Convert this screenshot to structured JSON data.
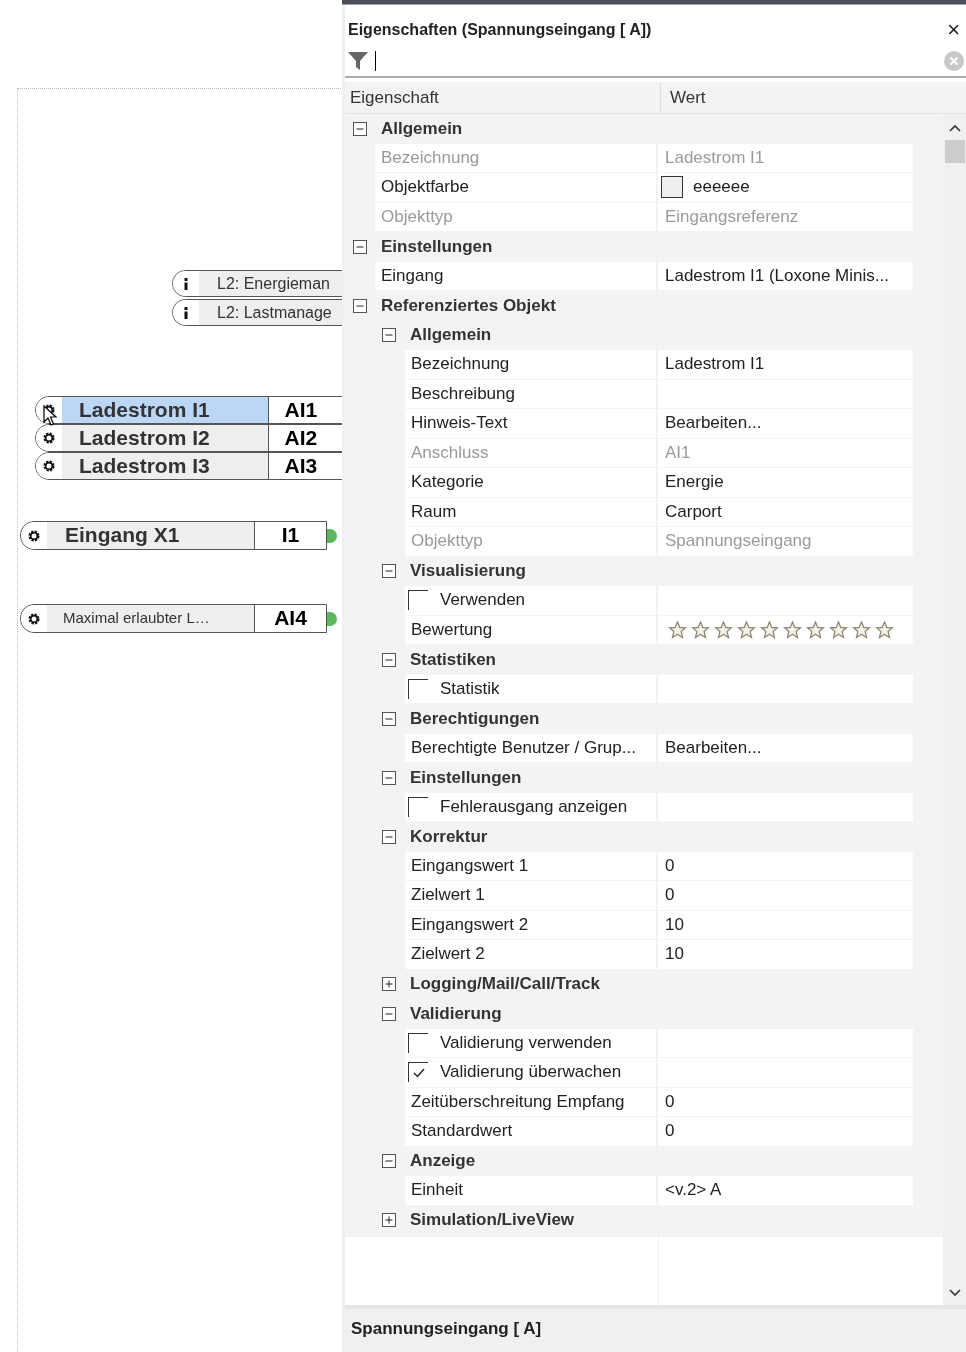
{
  "canvas": {
    "blocks": [
      {
        "kind": "info",
        "label": "L2: Energieman"
      },
      {
        "kind": "info",
        "label": "L2: Lastmanage"
      },
      {
        "kind": "group",
        "rows": [
          {
            "label": "Ladestrom I1",
            "port": "AI1",
            "selected": true
          },
          {
            "label": "Ladestrom I2",
            "port": "AI2",
            "selected": false
          },
          {
            "label": "Ladestrom I3",
            "port": "AI3",
            "selected": false
          }
        ]
      },
      {
        "kind": "input",
        "label": "Eingang X1",
        "port": "I1",
        "connected": true,
        "small": false
      },
      {
        "kind": "input",
        "label": "Maximal  erlaubter L…",
        "port": "AI4",
        "connected": true,
        "small": true
      }
    ]
  },
  "panel": {
    "title": "Eigenschaften (Spannungseingang [ A])",
    "close": "×",
    "columns": [
      "Eigenschaft",
      "Wert"
    ],
    "properties": [
      {
        "kind": "category",
        "label": "Allgemein",
        "expanded": true,
        "children": [
          {
            "kind": "text",
            "name": "Bezeichnung",
            "value": "Ladestrom I1",
            "disabled": true
          },
          {
            "kind": "color",
            "name": "Objektfarbe",
            "value": "eeeeee",
            "color": "#eeeeee"
          },
          {
            "kind": "text",
            "name": "Objekttyp",
            "value": "Eingangsreferenz",
            "disabled": true
          }
        ]
      },
      {
        "kind": "category",
        "label": "Einstellungen",
        "expanded": true,
        "children": [
          {
            "kind": "text",
            "name": "Eingang",
            "value": "Ladestrom I1 (Loxone Minis...",
            "disabled": false
          }
        ]
      },
      {
        "kind": "category",
        "label": "Referenziertes Objekt",
        "expanded": true,
        "children": [
          {
            "kind": "category",
            "label": "Allgemein",
            "expanded": true,
            "children": [
              {
                "kind": "text",
                "name": "Bezeichnung",
                "value": "Ladestrom I1",
                "disabled": false
              },
              {
                "kind": "text",
                "name": "Beschreibung",
                "disabled": false
              },
              {
                "kind": "text",
                "name": "Hinweis-Text",
                "value": "Bearbeiten...",
                "disabled": false
              },
              {
                "kind": "text",
                "name": "Anschluss",
                "value": "AI1",
                "disabled": true
              },
              {
                "kind": "text",
                "name": "Kategorie",
                "value": "Energie",
                "disabled": false
              },
              {
                "kind": "text",
                "name": "Raum",
                "value": "Carport",
                "disabled": false
              },
              {
                "kind": "text",
                "name": "Objekttyp",
                "value": "Spannungseingang",
                "disabled": true
              }
            ]
          },
          {
            "kind": "category",
            "label": "Visualisierung",
            "expanded": true,
            "children": [
              {
                "kind": "checkbox",
                "label": "Verwenden",
                "checked": false
              },
              {
                "kind": "stars",
                "name": "Bewertung",
                "stars": 0
              }
            ]
          },
          {
            "kind": "category",
            "label": "Statistiken",
            "expanded": true,
            "children": [
              {
                "kind": "checkbox",
                "label": "Statistik",
                "checked": false
              }
            ]
          },
          {
            "kind": "category",
            "label": "Berechtigungen",
            "expanded": true,
            "children": [
              {
                "kind": "text",
                "name": "Berechtigte Benutzer / Grup...",
                "value": "Bearbeiten...",
                "disabled": false
              }
            ]
          },
          {
            "kind": "category",
            "label": "Einstellungen",
            "expanded": true,
            "children": [
              {
                "kind": "checkbox",
                "label": "Fehlerausgang anzeigen",
                "checked": false
              }
            ]
          },
          {
            "kind": "category",
            "label": "Korrektur",
            "expanded": true,
            "children": [
              {
                "kind": "text",
                "name": "Eingangswert 1",
                "value": "0",
                "disabled": false
              },
              {
                "kind": "text",
                "name": "Zielwert 1",
                "value": "0",
                "disabled": false
              },
              {
                "kind": "text",
                "name": "Eingangswert 2",
                "value": "10",
                "disabled": false
              },
              {
                "kind": "text",
                "name": "Zielwert 2",
                "value": "10",
                "disabled": false
              }
            ]
          },
          {
            "kind": "category",
            "label": "Logging/Mail/Call/Track",
            "expanded": false
          },
          {
            "kind": "category",
            "label": "Validierung",
            "expanded": true,
            "children": [
              {
                "kind": "checkbox",
                "label": "Validierung verwenden",
                "checked": false
              },
              {
                "kind": "checkbox",
                "label": "Validierung überwachen",
                "checked": true
              },
              {
                "kind": "text",
                "name": "Zeitüberschreitung Empfang",
                "value": "0",
                "disabled": false
              },
              {
                "kind": "text",
                "name": "Standardwert",
                "value": "0",
                "disabled": false
              }
            ]
          },
          {
            "kind": "category",
            "label": "Anzeige",
            "expanded": true,
            "children": [
              {
                "kind": "text",
                "name": "Einheit",
                "value": "<v.2> A",
                "disabled": false
              }
            ]
          },
          {
            "kind": "category",
            "label": "Simulation/LiveView",
            "expanded": false
          }
        ]
      }
    ]
  },
  "description": "Spannungseingang [ A]"
}
